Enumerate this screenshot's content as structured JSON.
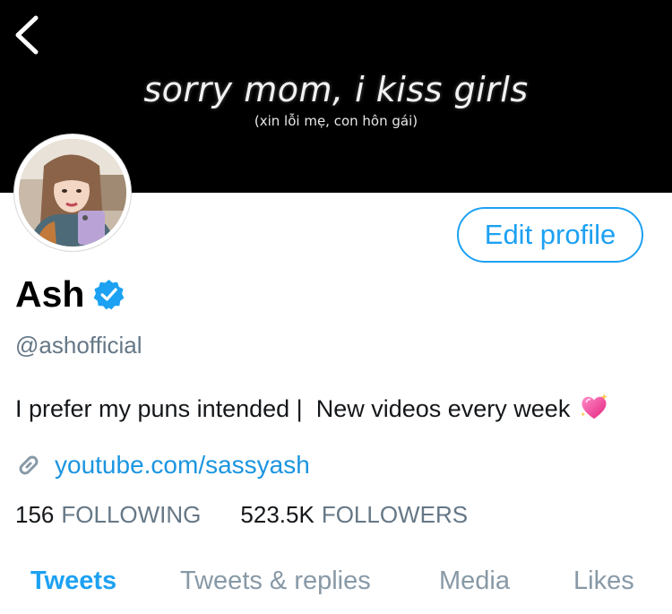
{
  "banner": {
    "title": "sorry mom, i kiss girls",
    "subtitle": "(xin lỗi mẹ, con hôn gái)"
  },
  "icons": {
    "back": "chevron-left-icon",
    "verified": "verified-badge-icon",
    "link": "link-icon",
    "bio_emoji": "sparkling-heart-icon"
  },
  "colors": {
    "accent": "#1da1f2",
    "link": "#1b95e0",
    "muted": "#657786",
    "banner_bg": "#000000"
  },
  "profile": {
    "edit_label": "Edit profile",
    "name": "Ash",
    "handle": "@ashofficial",
    "bio": "I prefer my puns intended |  New videos every week",
    "link": "youtube.com/sassyash"
  },
  "stats": {
    "following_count": "156",
    "following_label": "FOLLOWING",
    "followers_count": "523.5K",
    "followers_label": "FOLLOWERS"
  },
  "tabs": [
    {
      "label": "Tweets",
      "active": true
    },
    {
      "label": "Tweets & replies",
      "active": false
    },
    {
      "label": "Media",
      "active": false
    },
    {
      "label": "Likes",
      "active": false
    }
  ]
}
